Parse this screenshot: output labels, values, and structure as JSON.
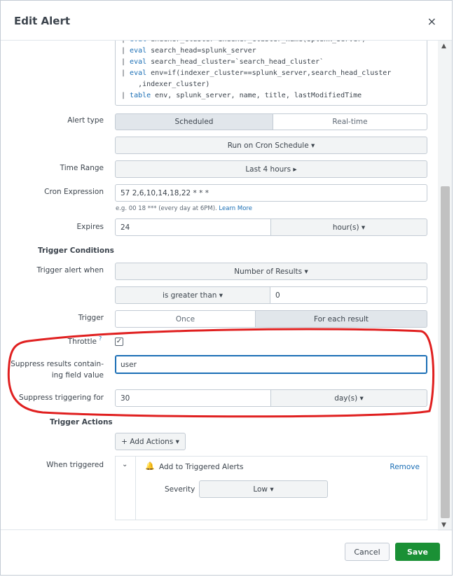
{
  "dialog": {
    "title": "Edit Alert",
    "close_symbol": "×"
  },
  "query_lines": [
    {
      "pipe": "| ",
      "kw": "eval",
      "rest": " indexer_cluster=indexer_cluster_name(splunk_server)"
    },
    {
      "pipe": "| ",
      "kw": "eval",
      "rest": " search_head=splunk_server"
    },
    {
      "pipe": "| ",
      "kw": "eval",
      "rest": " search_head_cluster=`search_head_cluster`"
    },
    {
      "pipe": "| ",
      "kw": "eval",
      "rest": " env=if(indexer_cluster==splunk_server,search_head_cluster"
    },
    {
      "pipe": "",
      "kw": "",
      "rest": "    ,indexer_cluster)"
    },
    {
      "pipe": "| ",
      "kw": "table",
      "rest": " env, splunk_server, name, title, lastModifiedTime"
    }
  ],
  "alert_type": {
    "label": "Alert type",
    "options": [
      "Scheduled",
      "Real-time"
    ],
    "selected": "Scheduled",
    "schedule_dropdown": "Run on Cron Schedule ▾"
  },
  "time_range": {
    "label": "Time Range",
    "value": "Last 4 hours ▸"
  },
  "cron": {
    "label": "Cron Expression",
    "value": "57 2,6,10,14,18,22 * * *",
    "hint": "e.g. 00 18 *** (every day at 6PM).",
    "hint_link": "Learn More"
  },
  "expires": {
    "label": "Expires",
    "value": "24",
    "unit": "hour(s) ▾"
  },
  "trigger_conditions": {
    "heading": "Trigger Conditions",
    "when_label": "Trigger alert when",
    "when_value": "Number of Results ▾",
    "comparator": "is greater than ▾",
    "threshold": "0",
    "trigger_label": "Trigger",
    "trigger_options": [
      "Once",
      "For each result"
    ],
    "trigger_selected": "For each result"
  },
  "throttle": {
    "label": "Throttle",
    "help": "?",
    "checked": true,
    "check_symbol": "✓",
    "suppress_field_label_1": "Suppress results contain-",
    "suppress_field_label_2": "ing field value",
    "suppress_field_value": "user",
    "suppress_for_label": "Suppress triggering for",
    "suppress_for_value": "30",
    "suppress_for_unit": "day(s) ▾"
  },
  "trigger_actions": {
    "heading": "Trigger Actions",
    "add_button": "+ Add Actions ▾",
    "when_triggered_label": "When triggered",
    "action_name": "Add to Triggered Alerts",
    "remove": "Remove",
    "severity_label": "Severity",
    "severity_value": "Low ▾"
  },
  "footer": {
    "cancel": "Cancel",
    "save": "Save"
  },
  "colors": {
    "accent": "#1a6eb5",
    "save": "#1a9035",
    "annotation": "#e02020"
  }
}
